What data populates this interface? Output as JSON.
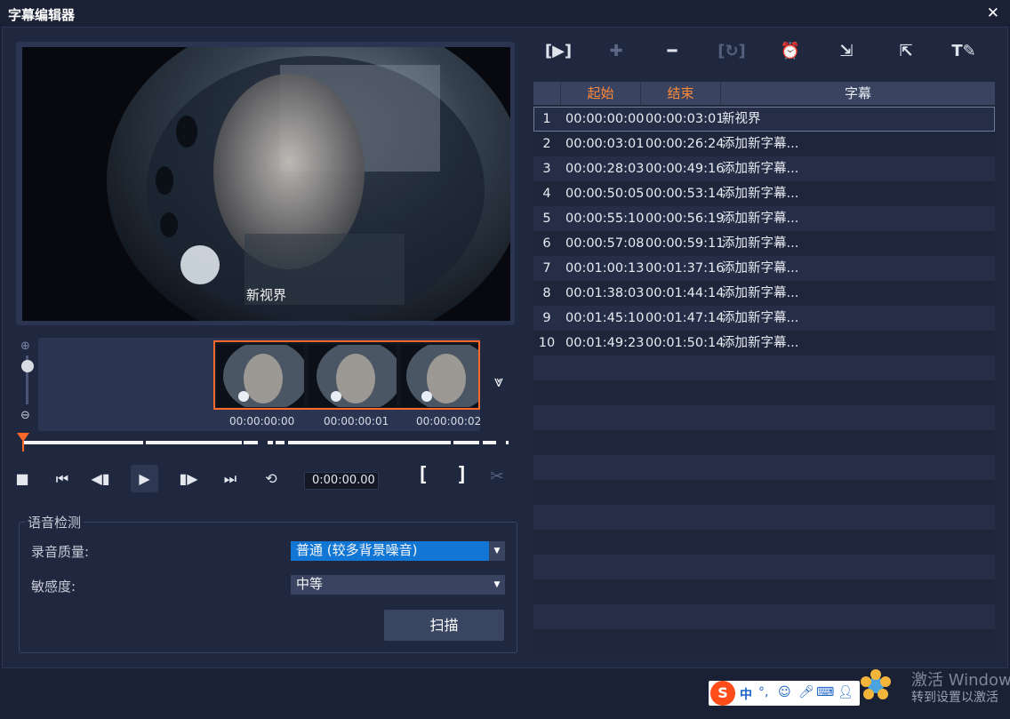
{
  "window": {
    "title": "字幕编辑器",
    "close_label": "✕"
  },
  "preview": {
    "subtitle_overlay": "新视界"
  },
  "filmstrip": {
    "timecodes": [
      "00:00:00:00",
      "00:00:00:01",
      "00:00:00:02"
    ]
  },
  "transport": {
    "stop": "■",
    "to_start": "⏮",
    "prev_frame": "◀▮",
    "play": "▶",
    "next_frame": "▮▶",
    "to_end": "⏭",
    "repeat": "⟲",
    "timecode": "0:00:00.00",
    "mark_in": "[",
    "mark_out": "]"
  },
  "voice_detection": {
    "legend": "语音检测",
    "quality_label": "录音质量:",
    "quality_value": "普通 (较多背景噪音)",
    "sensitivity_label": "敏感度:",
    "sensitivity_value": "中等",
    "scan_label": "扫描"
  },
  "toolbar_icons": [
    "play-subtitle-icon",
    "add-icon",
    "remove-icon",
    "merge-icon",
    "alarm-icon",
    "import-icon",
    "export-icon",
    "text-style-icon"
  ],
  "table": {
    "headers": {
      "start": "起始",
      "end": "结束",
      "text": "字幕"
    },
    "rows": [
      {
        "idx": "1",
        "start": "00:00:00:00",
        "end": "00:00:03:01",
        "text": "新视界"
      },
      {
        "idx": "2",
        "start": "00:00:03:01",
        "end": "00:00:26:24",
        "text": "添加新字幕..."
      },
      {
        "idx": "3",
        "start": "00:00:28:03",
        "end": "00:00:49:16",
        "text": "添加新字幕..."
      },
      {
        "idx": "4",
        "start": "00:00:50:05",
        "end": "00:00:53:14",
        "text": "添加新字幕..."
      },
      {
        "idx": "5",
        "start": "00:00:55:10",
        "end": "00:00:56:19",
        "text": "添加新字幕..."
      },
      {
        "idx": "6",
        "start": "00:00:57:08",
        "end": "00:00:59:11",
        "text": "添加新字幕..."
      },
      {
        "idx": "7",
        "start": "00:01:00:13",
        "end": "00:01:37:16",
        "text": "添加新字幕..."
      },
      {
        "idx": "8",
        "start": "00:01:38:03",
        "end": "00:01:44:14",
        "text": "添加新字幕..."
      },
      {
        "idx": "9",
        "start": "00:01:45:10",
        "end": "00:01:47:14",
        "text": "添加新字幕..."
      },
      {
        "idx": "10",
        "start": "00:01:49:23",
        "end": "00:01:50:14",
        "text": "添加新字幕..."
      }
    ]
  },
  "taskbar": {
    "ime_logo": "S",
    "ime_lang": "中",
    "watermark_line1": "激活 Windows",
    "watermark_line2": "转到设置以激活"
  },
  "colors": {
    "accent": "#ff6a2a",
    "highlight": "#1276d4",
    "header_orange": "#ff8a3a"
  }
}
